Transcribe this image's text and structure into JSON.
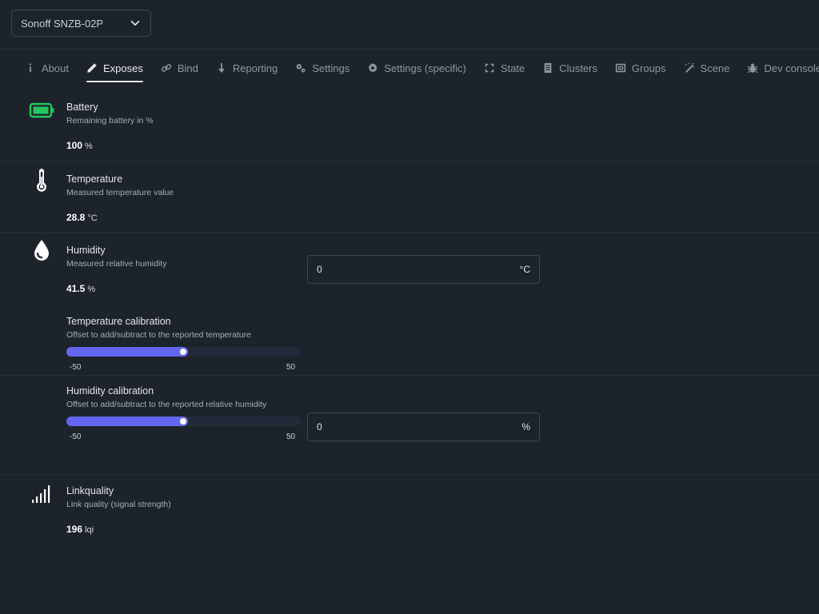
{
  "device_select": {
    "value": "Sonoff SNZB-02P"
  },
  "tabs": [
    {
      "label": "About",
      "icon": "info-icon"
    },
    {
      "label": "Exposes",
      "icon": "pencil-icon",
      "active": true
    },
    {
      "label": "Bind",
      "icon": "link-icon"
    },
    {
      "label": "Reporting",
      "icon": "arrow-down-icon"
    },
    {
      "label": "Settings",
      "icon": "gears-icon"
    },
    {
      "label": "Settings (specific)",
      "icon": "gear-icon"
    },
    {
      "label": "State",
      "icon": "refresh-icon"
    },
    {
      "label": "Clusters",
      "icon": "document-icon"
    },
    {
      "label": "Groups",
      "icon": "group-icon"
    },
    {
      "label": "Scene",
      "icon": "magic-wand-icon"
    },
    {
      "label": "Dev console",
      "icon": "bug-icon"
    }
  ],
  "exposes": {
    "battery": {
      "title": "Battery",
      "desc": "Remaining battery in %",
      "value": "100",
      "unit": "%",
      "icon": "battery-full-icon",
      "icon_color": "#22c55e"
    },
    "temperature": {
      "title": "Temperature",
      "desc": "Measured temperature value",
      "value": "28.8",
      "unit": "°C",
      "icon": "thermometer-icon"
    },
    "humidity": {
      "title": "Humidity",
      "desc": "Measured relative humidity",
      "value": "41.5",
      "unit": "%",
      "icon": "water-drop-icon"
    },
    "temperature_calibration": {
      "title": "Temperature calibration",
      "desc": "Offset to add/subtract to the reported temperature",
      "min": "-50",
      "max": "50",
      "value": "0",
      "unit": "°C",
      "slider_fraction": 0.5
    },
    "humidity_calibration": {
      "title": "Humidity calibration",
      "desc": "Offset to add/subtract to the reported relative humidity",
      "min": "-50",
      "max": "50",
      "value": "0",
      "unit": "%",
      "slider_fraction": 0.5
    },
    "linkquality": {
      "title": "Linkquality",
      "desc": "Link quality (signal strength)",
      "value": "196",
      "unit": "lqi",
      "icon": "signal-bars-icon"
    }
  },
  "colors": {
    "accent": "#6366f1",
    "background": "#1d232a"
  }
}
